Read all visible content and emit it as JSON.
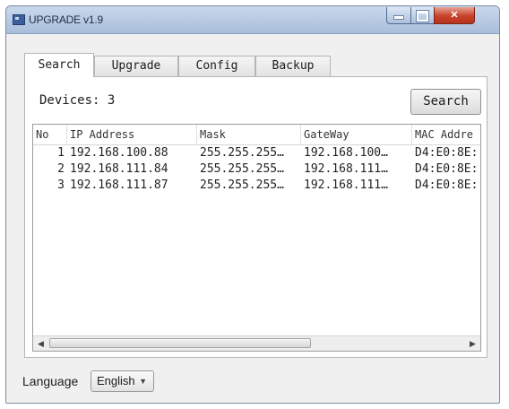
{
  "window": {
    "title": "UPGRADE v1.9"
  },
  "tabs": [
    {
      "label": "Search",
      "active": true
    },
    {
      "label": "Upgrade",
      "active": false
    },
    {
      "label": "Config",
      "active": false
    },
    {
      "label": "Backup",
      "active": false
    }
  ],
  "search_tab": {
    "devices_text": "Devices: 3",
    "search_button": "Search",
    "columns": [
      "No",
      "IP Address",
      "Mask",
      "GateWay",
      "MAC Addre"
    ],
    "rows": [
      {
        "no": "1",
        "ip": "192.168.100.88",
        "mask": "255.255.255…",
        "gateway": "192.168.100…",
        "mac": "D4:E0:8E:"
      },
      {
        "no": "2",
        "ip": "192.168.111.84",
        "mask": "255.255.255…",
        "gateway": "192.168.111…",
        "mac": "D4:E0:8E:"
      },
      {
        "no": "3",
        "ip": "192.168.111.87",
        "mask": "255.255.255…",
        "gateway": "192.168.111…",
        "mac": "D4:E0:8E:"
      }
    ]
  },
  "footer": {
    "language_label": "Language",
    "language_value": "English"
  },
  "colors": {
    "titlebar": "#b7cae3",
    "close_button": "#c7402a",
    "panel_bg": "#ffffff",
    "window_bg": "#f0f0f0"
  }
}
